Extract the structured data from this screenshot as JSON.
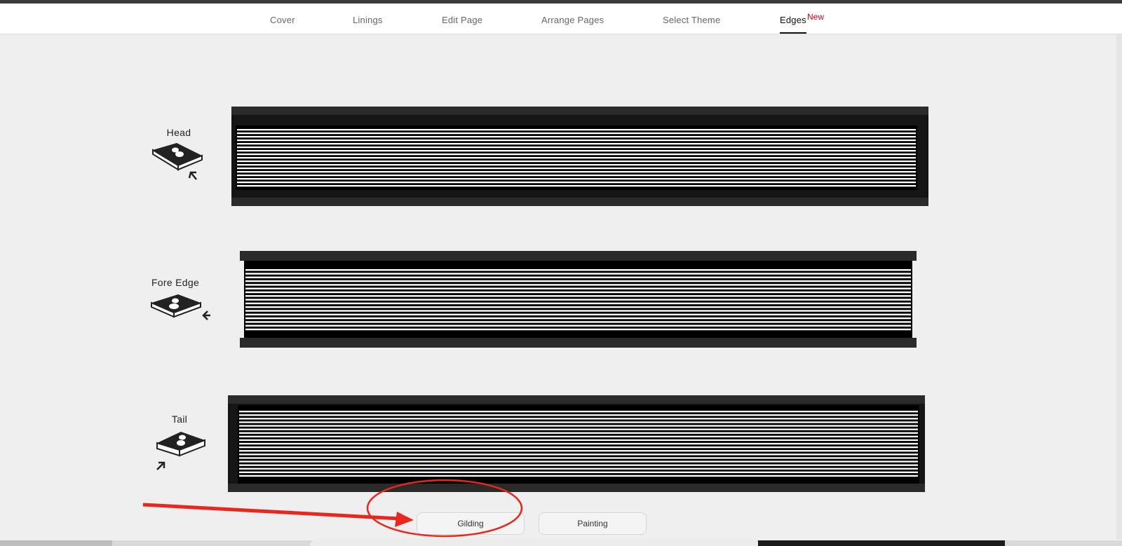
{
  "nav": {
    "tabs": [
      {
        "label": "Cover"
      },
      {
        "label": "Linings"
      },
      {
        "label": "Edit Page"
      },
      {
        "label": "Arrange Pages"
      },
      {
        "label": "Select Theme"
      },
      {
        "label": "Edges"
      }
    ],
    "active_tab": "Edges",
    "new_badge": "New"
  },
  "edges": [
    {
      "label": "Head",
      "icon": "book-head-icon"
    },
    {
      "label": "Fore Edge",
      "icon": "book-fore-edge-icon"
    },
    {
      "label": "Tail",
      "icon": "book-tail-icon"
    }
  ],
  "options": {
    "gilding": "Gilding",
    "painting": "Painting"
  },
  "colors": {
    "badge": "#d0021b",
    "annotation": "#e8281e",
    "book": "#111111"
  }
}
